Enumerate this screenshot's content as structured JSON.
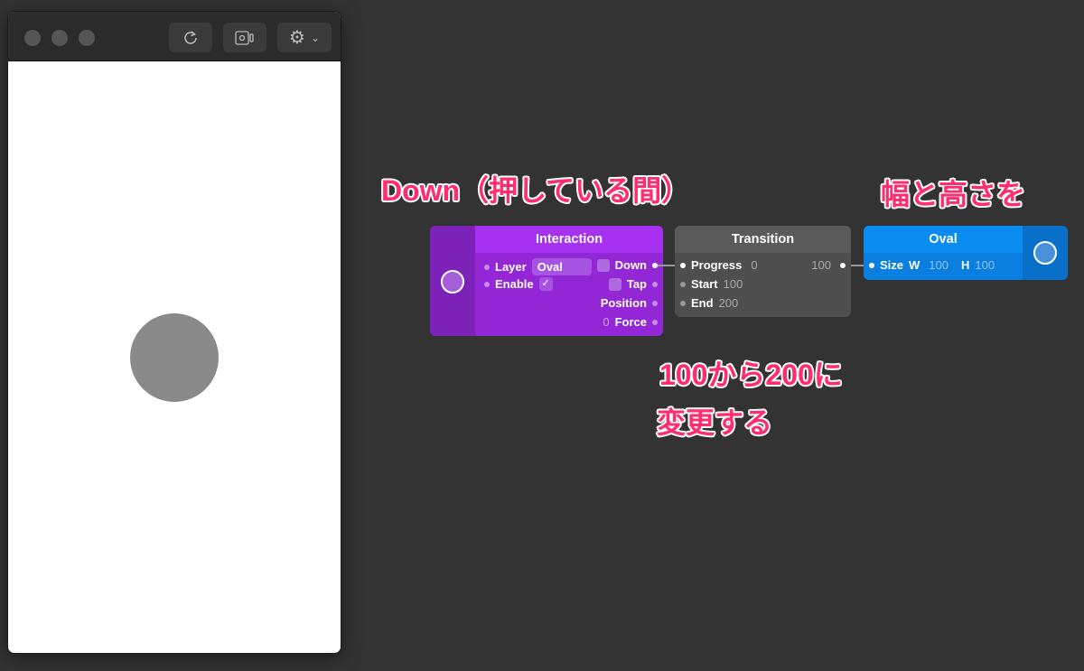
{
  "window": {
    "buttons": [
      "reload-icon",
      "record-icon",
      "gear-icon"
    ]
  },
  "nodes": {
    "interaction": {
      "title": "Interaction",
      "layer_label": "Layer",
      "layer_value": "Oval",
      "enable_label": "Enable",
      "enable_checked": "✓",
      "down": "Down",
      "tap": "Tap",
      "position": "Position",
      "force": "Force",
      "force_value": "0",
      "color": "#9b2bd9"
    },
    "transition": {
      "title": "Transition",
      "progress": "Progress",
      "progress_value": "0",
      "output_value": "100",
      "start": "Start",
      "start_value": "100",
      "end": "End",
      "end_value": "200",
      "color": "#555555"
    },
    "oval": {
      "title": "Oval",
      "size": "Size",
      "w": "W",
      "w_value": "100",
      "h": "H",
      "h_value": "100",
      "color": "#0a8cf0"
    }
  },
  "annotations": {
    "down": "Down（押している間）",
    "size": "幅と高さを",
    "range_line1": "100から200に",
    "range_line2": "変更する"
  }
}
